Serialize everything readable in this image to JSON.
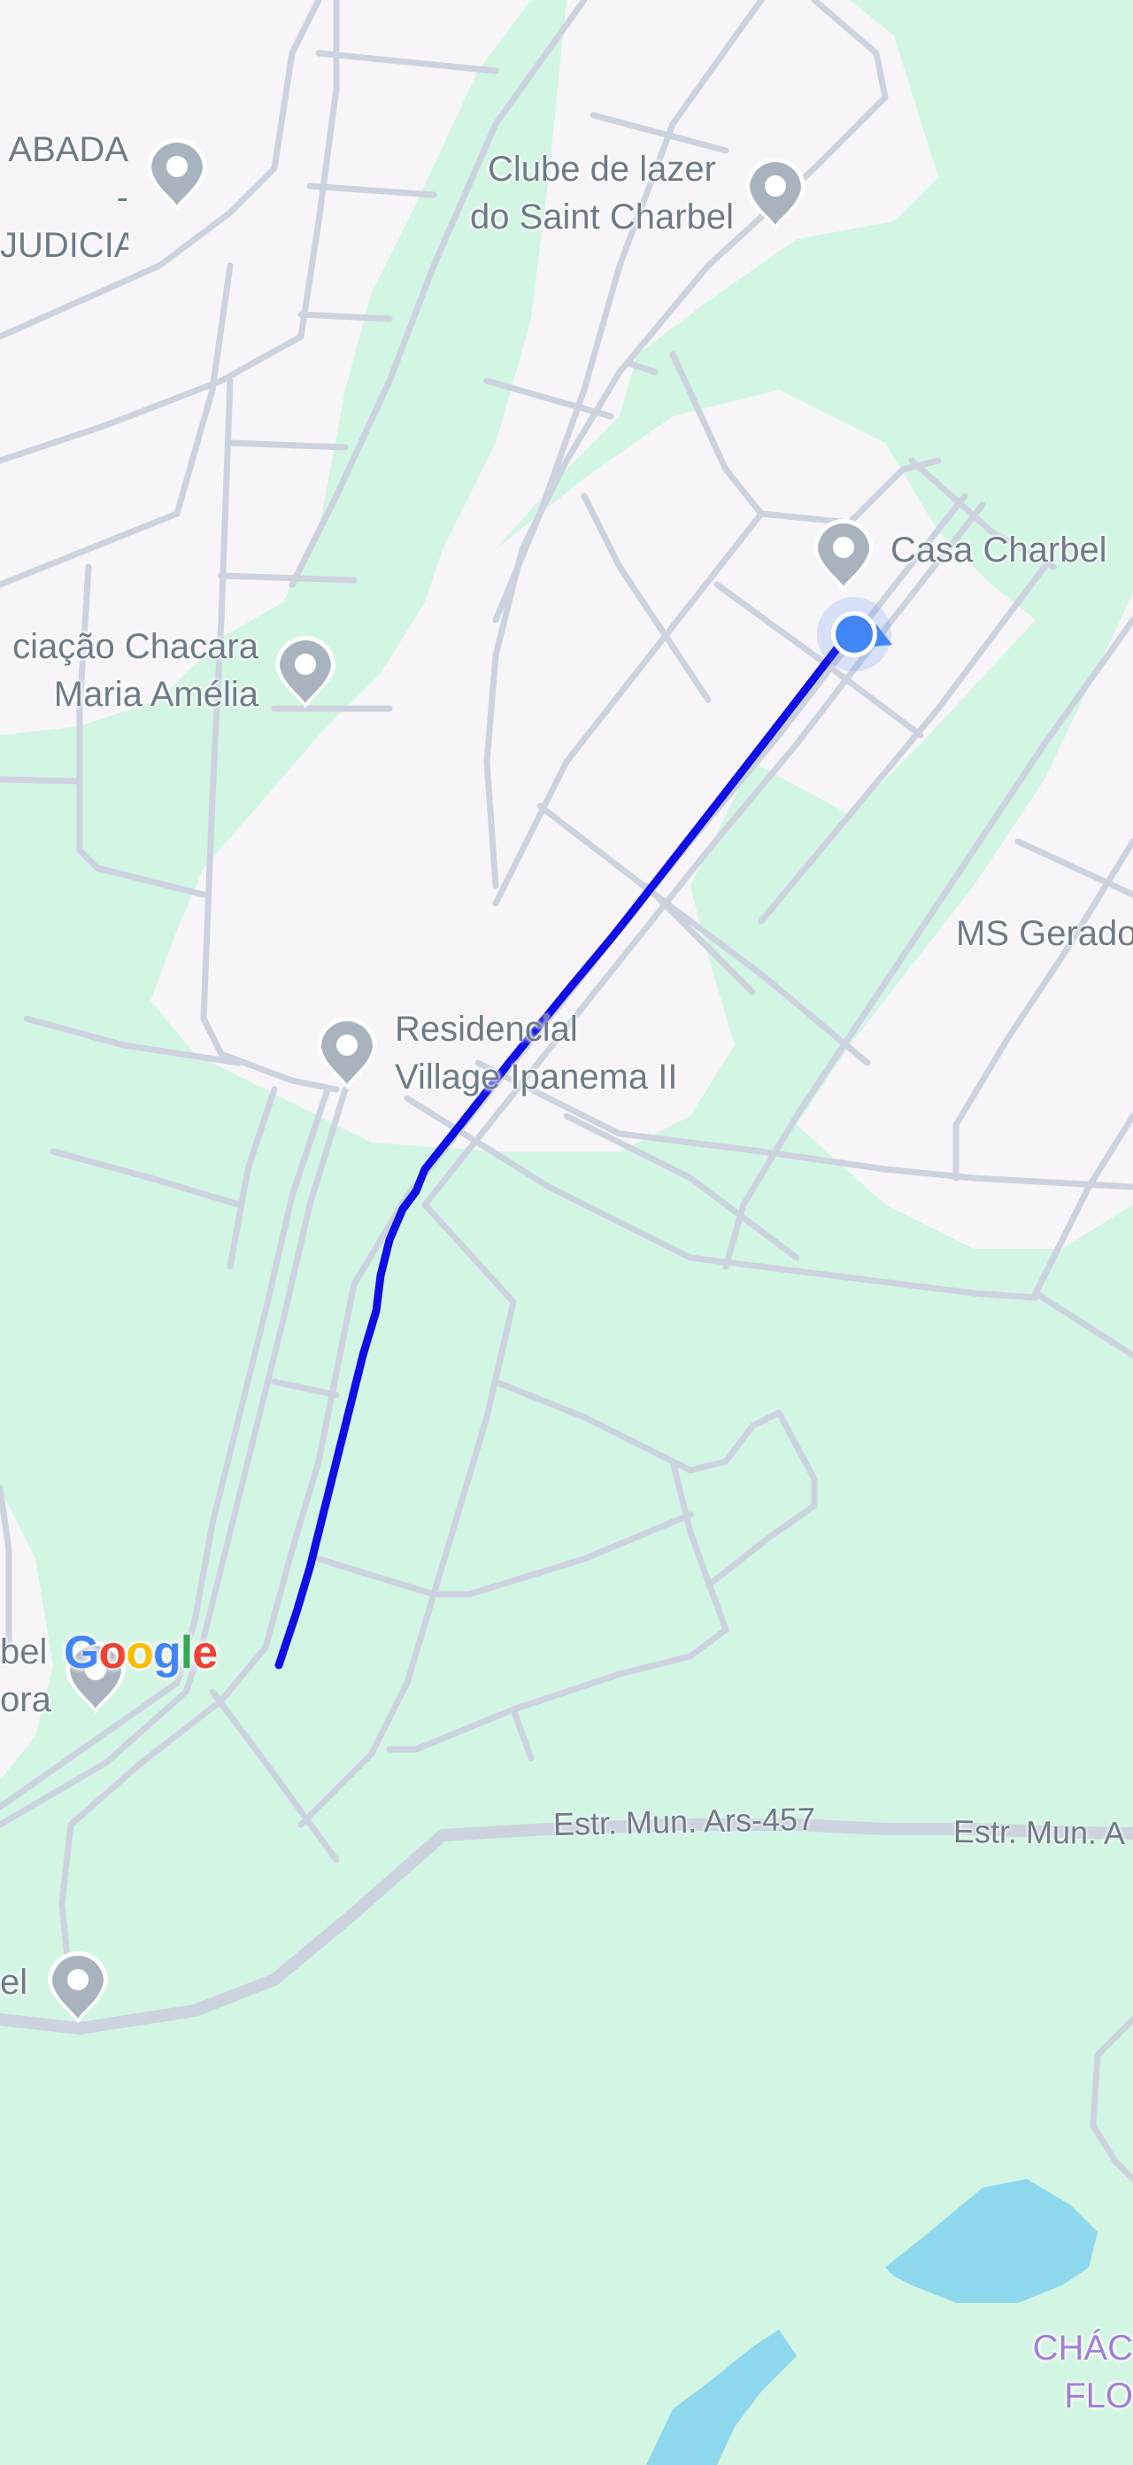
{
  "places": [
    {
      "id": "place-abada",
      "name": "ABADA -\nJUDICIAL"
    },
    {
      "id": "place-clube",
      "name": "Clube de lazer\ndo Saint Charbel"
    },
    {
      "id": "place-casa-charbel",
      "name": "Casa Charbel"
    },
    {
      "id": "place-associacao",
      "name": "ciação Chacara\nMaria Amélia"
    },
    {
      "id": "place-residencial",
      "name": "Residencial\nVillage Ipanema II"
    },
    {
      "id": "place-ms-gerado",
      "name": "MS Gerado"
    },
    {
      "id": "place-bottom-left",
      "name": "bel\nora"
    },
    {
      "id": "place-el",
      "name": "el"
    },
    {
      "id": "place-chacara",
      "name": "CHÁC\nFLO"
    }
  ],
  "roads": {
    "estrada_1": "Estr. Mun. Ars-457",
    "estrada_2": "Estr. Mun. A"
  },
  "logo": {
    "letters": [
      {
        "ch": "G",
        "color": "#4285F4"
      },
      {
        "ch": "o",
        "color": "#EA4335"
      },
      {
        "ch": "o",
        "color": "#FBBC05"
      },
      {
        "ch": "g",
        "color": "#4285F4"
      },
      {
        "ch": "l",
        "color": "#34A853"
      },
      {
        "ch": "e",
        "color": "#EA4335"
      }
    ]
  },
  "colors": {
    "park": "#d3f5e3",
    "urban": "#f7f5f8",
    "road": "#cdd3de",
    "water": "#8ed8ed",
    "route": "#0f0ee6",
    "location": "#4285f4",
    "pin": "#a8b3bd"
  }
}
